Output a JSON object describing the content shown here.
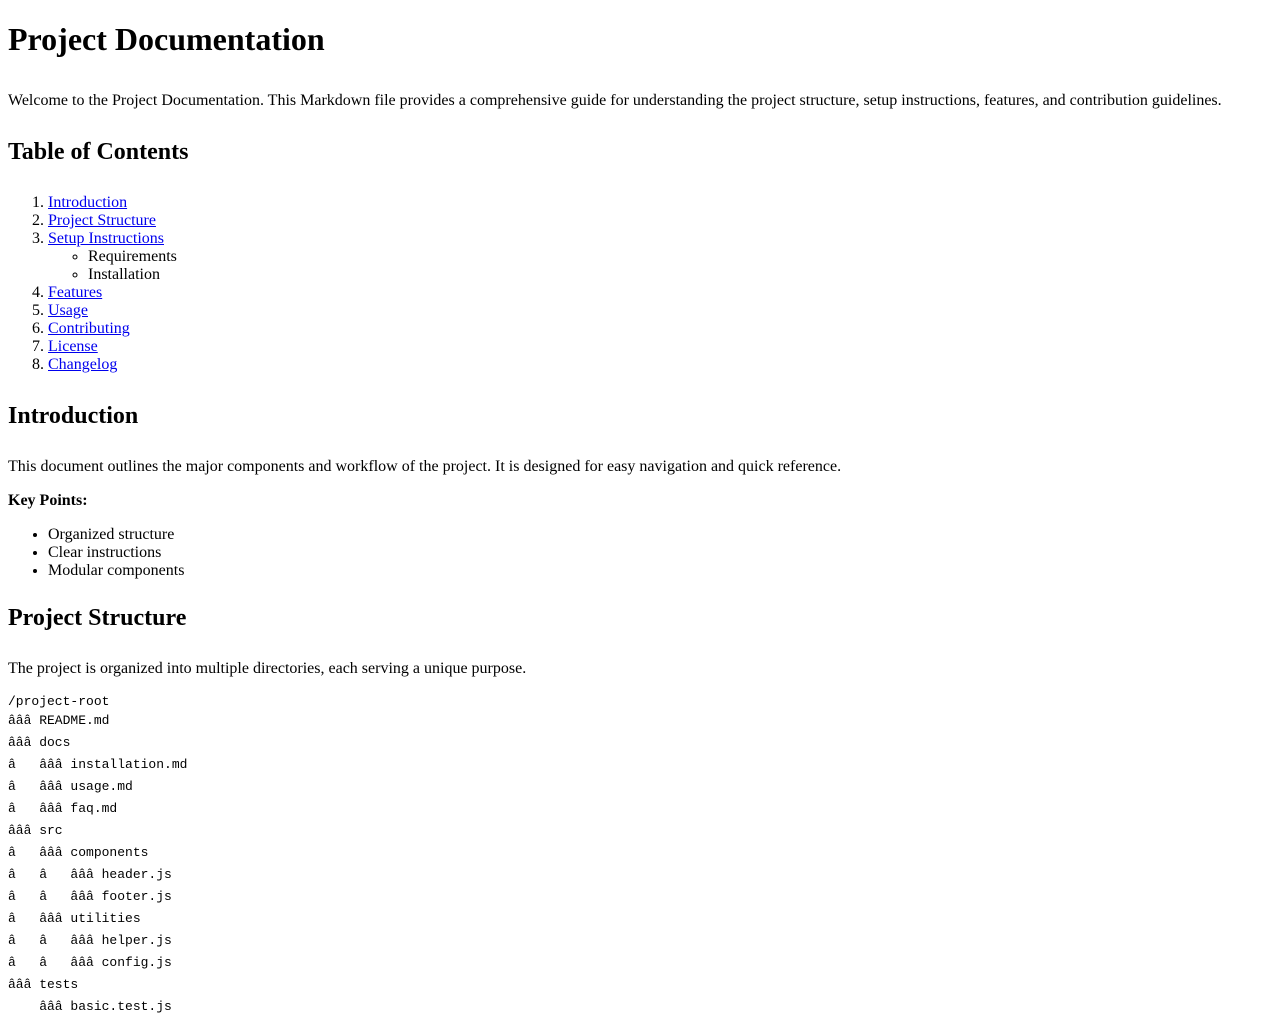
{
  "title": "Project Documentation",
  "intro_paragraph": "Welcome to the Project Documentation. This Markdown file provides a comprehensive guide for understanding the project structure, setup instructions, features, and contribution guidelines.",
  "toc": {
    "heading": "Table of Contents",
    "items": [
      {
        "label": "Introduction"
      },
      {
        "label": "Project Structure"
      },
      {
        "label": "Setup Instructions",
        "children": [
          "Requirements",
          "Installation"
        ]
      },
      {
        "label": "Features"
      },
      {
        "label": "Usage"
      },
      {
        "label": "Contributing"
      },
      {
        "label": "License"
      },
      {
        "label": "Changelog"
      }
    ]
  },
  "introduction": {
    "heading": "Introduction",
    "paragraph": "This document outlines the major components and workflow of the project. It is designed for easy navigation and quick reference.",
    "key_points_label": "Key Points:",
    "key_points": [
      "Organized structure",
      "Clear instructions",
      "Modular components"
    ]
  },
  "project_structure": {
    "heading": "Project Structure",
    "paragraph": "The project is organized into multiple directories, each serving a unique purpose.",
    "tree": [
      "/project-root",
      "âââ README.md",
      "âââ docs",
      "â   âââ installation.md",
      "â   âââ usage.md",
      "â   âââ faq.md",
      "âââ src",
      "â   âââ components",
      "â   â   âââ header.js",
      "â   â   âââ footer.js",
      "â   âââ utilities",
      "â   â   âââ helper.js",
      "â   â   âââ config.js",
      "âââ tests",
      "    âââ basic.test.js"
    ]
  }
}
